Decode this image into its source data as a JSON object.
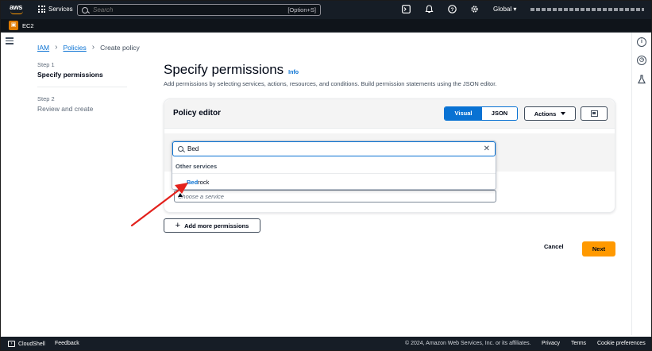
{
  "topnav": {
    "logo": "aws",
    "services_label": "Services",
    "search_placeholder": "Search",
    "search_shortcut": "[Option+S]",
    "region": "Global ▾",
    "icons": [
      "cloudshell-icon",
      "bell-icon",
      "help-icon",
      "gear-icon"
    ]
  },
  "favorites": {
    "ec2_label": "EC2"
  },
  "breadcrumb": {
    "items": [
      "IAM",
      "Policies"
    ],
    "current": "Create policy"
  },
  "wizard": {
    "steps": [
      {
        "number": "Step 1",
        "label": "Specify permissions"
      },
      {
        "number": "Step 2",
        "label": "Review and create"
      }
    ]
  },
  "main": {
    "title": "Specify permissions",
    "info": "Info",
    "description": "Add permissions by selecting services, actions, resources, and conditions. Build permission statements using the JSON editor."
  },
  "policy_editor": {
    "title": "Policy editor",
    "modes": [
      "Visual",
      "JSON"
    ],
    "actions_label": "Actions",
    "choose_service_placeholder": "Choose a service",
    "search_value": "Bed",
    "group_label": "Other services",
    "option_match": "Bed",
    "option_rest": "rock"
  },
  "buttons": {
    "add_more": "Add more permissions",
    "cancel": "Cancel",
    "next": "Next"
  },
  "footer": {
    "cloudshell": "CloudShell",
    "feedback": "Feedback",
    "copyright": "© 2024, Amazon Web Services, Inc. or its affiliates.",
    "privacy": "Privacy",
    "terms": "Terms",
    "cookies": "Cookie preferences"
  },
  "colors": {
    "nav_bg": "#161d26",
    "link_blue": "#0972d3",
    "primary_orange": "#ff9900",
    "annotation_red": "#e3211c"
  }
}
